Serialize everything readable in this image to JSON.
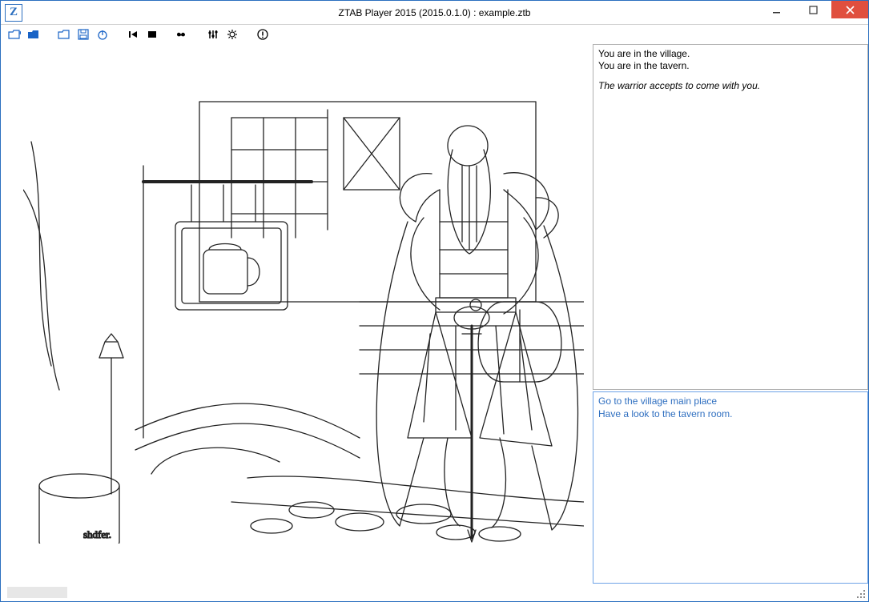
{
  "titlebar": {
    "app_icon_letter": "Z",
    "title": "ZTAB Player 2015 (2015.0.1.0) : example.ztb"
  },
  "toolbar": {
    "buttons": [
      {
        "name": "open-folder-icon"
      },
      {
        "name": "open-recent-icon"
      },
      {
        "name": "open-file-icon"
      },
      {
        "name": "save-icon"
      },
      {
        "name": "power-icon"
      },
      {
        "name": "rewind-first-icon"
      },
      {
        "name": "fullscreen-icon"
      },
      {
        "name": "view-mask-icon"
      },
      {
        "name": "equalizer-icon"
      },
      {
        "name": "settings-gear-icon"
      },
      {
        "name": "info-icon"
      }
    ]
  },
  "story": {
    "lines": [
      "You are in the village.",
      "You are in the tavern."
    ],
    "event": "The warrior accepts to come with you."
  },
  "choices": [
    "Go to the village main place",
    "Have a look to the tavern room."
  ],
  "scene_description": "Black-and-white sketch of an armored bearded warrior standing outside a tavern with a hanging mug sign, stone bridge, lantern, and medieval building."
}
